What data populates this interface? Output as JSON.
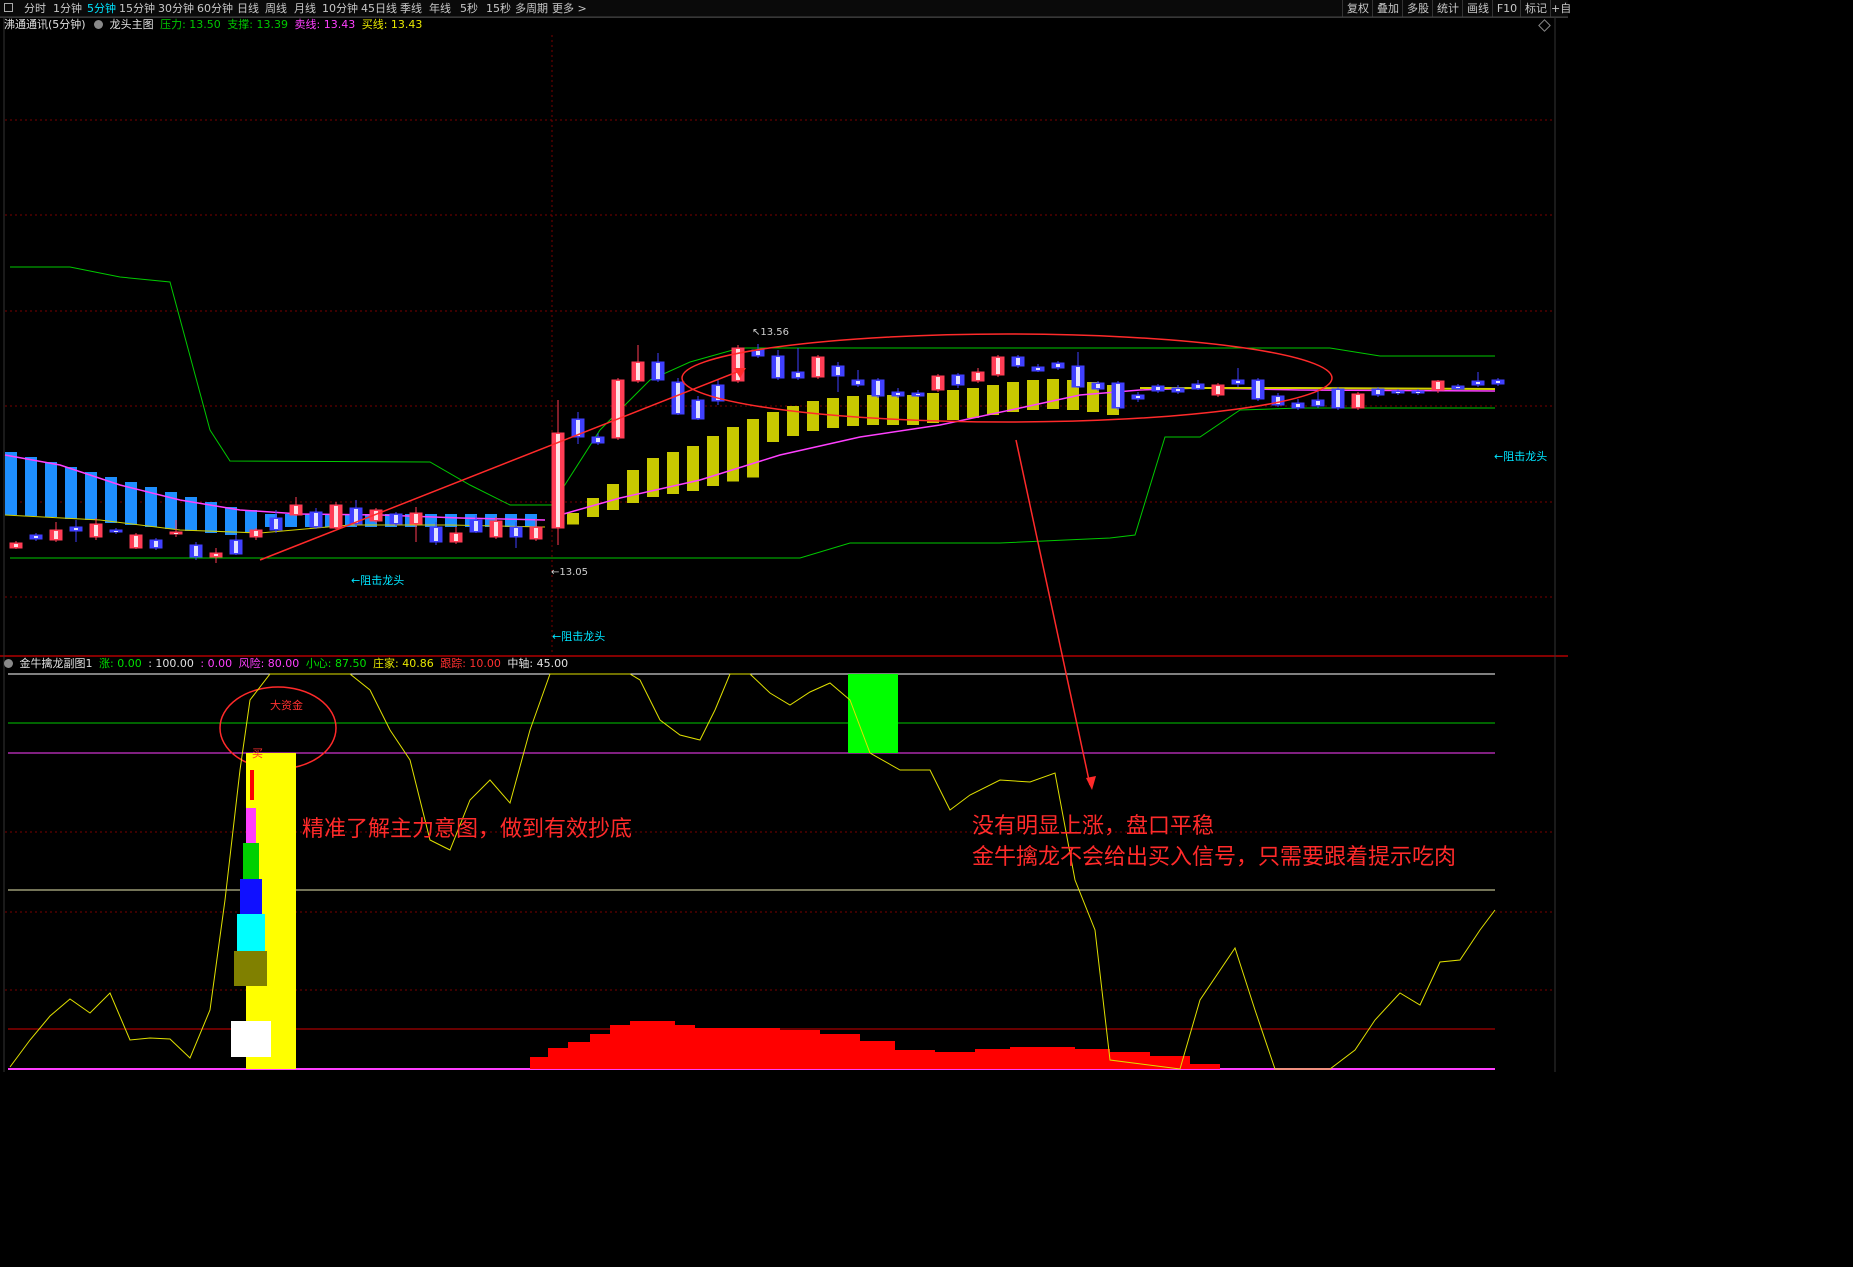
{
  "toolbar": {
    "periods": [
      "分时",
      "1分钟",
      "5分钟",
      "15分钟",
      "30分钟",
      "60分钟",
      "日线",
      "周线",
      "月线",
      "10分钟",
      "45日线",
      "季线",
      "年线",
      "5秒",
      "15秒",
      "多周期",
      "更多 >"
    ],
    "active_period": "5分钟",
    "right_buttons": [
      "复权",
      "叠加",
      "多股",
      "统计",
      "画线",
      "F10",
      "标记",
      "+自"
    ]
  },
  "main_chart": {
    "stock_title": "沸通通讯(5分钟)",
    "indicator_name": "龙头主图",
    "pressure_label": "压力: 13.50",
    "support_label": "支撑: 13.39",
    "sell_line_label": "卖线: 13.43",
    "buy_line_label": "买线: 13.43",
    "high_marker": "13.56",
    "low_marker": "13.05",
    "resist_labels": [
      "←阻击龙头",
      "←阻击龙头",
      "←阻击龙头"
    ]
  },
  "sub_chart": {
    "indicator_name": "金牛擒龙副图1",
    "zhang": "涨: 0.00",
    "val100": ": 100.00",
    "val0": ": 0.00",
    "fengxian": "风险: 80.00",
    "xiaoxin": "小心: 87.50",
    "zhuangjia": "庄家: 40.86",
    "genzong": "跟踪: 10.00",
    "zhongzhou": "中轴: 45.00",
    "big_fund_label": "大资金",
    "buy_label": "买"
  },
  "annotations": {
    "left_text": "精准了解主力意图，做到有效抄底",
    "right_text_line1": "没有明显上涨，盘口平稳",
    "right_text_line2": "金牛擒龙不会给出买入信号，只需要跟着提示吃肉"
  },
  "colors": {
    "up": "#ff3d55",
    "down": "#4040ff",
    "blue_bar": "#1e8fff",
    "yellow_bar": "#c8c800",
    "green_line": "#00c800",
    "magenta": "#ff40ff",
    "annotation": "#ff2a2a",
    "cyan": "#00e5ff"
  },
  "icons": [
    "panel-toggle-icon",
    "indicator-toggle-icon",
    "sub-indicator-toggle-icon",
    "diamond-icon"
  ]
}
